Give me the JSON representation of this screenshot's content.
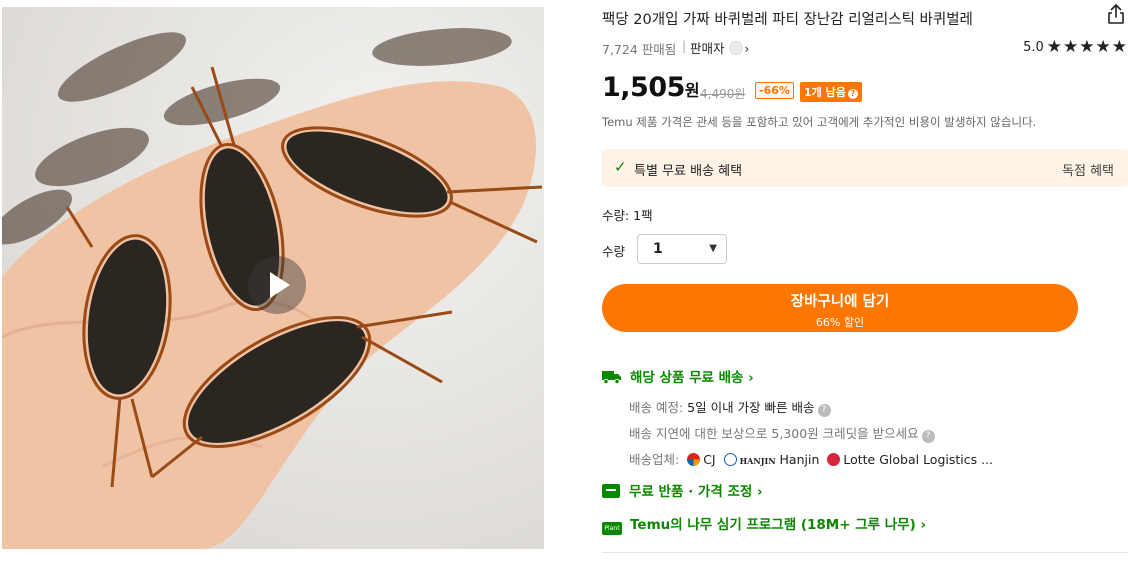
{
  "product": {
    "title": "팩당 20개입 가짜 바퀴벌레 파티 장난감 리얼리스틱 바퀴벌레",
    "image_alt": "hand holding realistic fake cockroaches",
    "sold_count": "7,724 판매됨",
    "separator": "|",
    "seller_label": "판매자",
    "rating": "5.0",
    "stars": "★★★★★"
  },
  "price": {
    "current": "1,505",
    "currency": "원",
    "original": "4,490원",
    "discount": "-66%",
    "stock_badge": "1개 남음",
    "notice": "Temu 제품 가격은 관세 등을 포함하고 있어 고객에게 추가적인 비용이 발생하지 않습니다."
  },
  "promo": {
    "label": "특별 무료 배송 혜택",
    "exclusive": "독점 혜택"
  },
  "quantity": {
    "pack_text": "수량: 1팩",
    "label": "수량",
    "value": "1"
  },
  "cart": {
    "label": "장바구니에 담기",
    "sub": "66% 할인"
  },
  "shipping": {
    "headline": "해당 상품 무료 배송",
    "eta_label": "배송 예정:",
    "eta_value": "5일 이내 가장 빠른 배송",
    "credit_text": "배송 지연에 대한 보상으로 5,300원 크레딧을 받으세요",
    "carrier_label": "배송업체:",
    "carrier_cj": "CJ",
    "carrier_hanjin_logo": "HANJIN",
    "carrier_hanjin": "Hanjin",
    "carrier_lotte": "Lotte Global Logistics ..."
  },
  "returns": {
    "headline": "무료 반품 · 가격 조정"
  },
  "tree": {
    "badge": "Plant",
    "headline": "Temu의 나무 심기 프로그램 (18M+ 그루 나무)"
  },
  "icons": {
    "share": "share-icon",
    "play": "play-icon",
    "truck": "truck-icon",
    "check": "check-icon"
  },
  "colors": {
    "accent": "#fb7701",
    "green": "#0a8800",
    "promo_bg": "#fff3e8"
  }
}
